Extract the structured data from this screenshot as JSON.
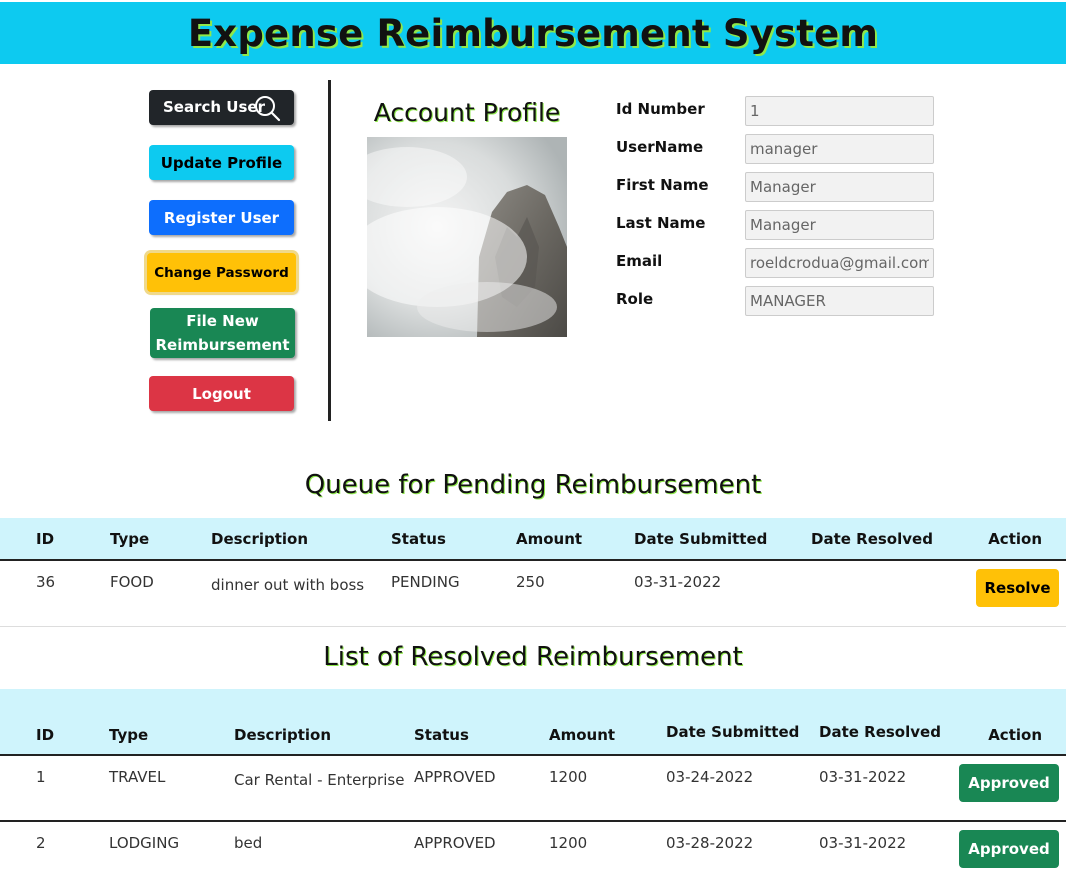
{
  "header": {
    "title": "Expense Reimbursement System"
  },
  "sidebar": {
    "search_label": "Search User",
    "update_label": "Update Profile",
    "register_label": "Register User",
    "change_password_label": "Change Password",
    "file_label": "File New\nReimbursement",
    "logout_label": "Logout"
  },
  "profile": {
    "title": "Account Profile",
    "fields": [
      {
        "label": "Id Number",
        "value": "1"
      },
      {
        "label": "UserName",
        "value": "manager"
      },
      {
        "label": "First Name",
        "value": "Manager"
      },
      {
        "label": "Last Name",
        "value": "Manager"
      },
      {
        "label": "Email",
        "value": "roeldcrodua@gmail.com"
      },
      {
        "label": "Role",
        "value": "MANAGER"
      }
    ]
  },
  "pending": {
    "title": "Queue for Pending Reimbursement",
    "headers": [
      "ID",
      "Type",
      "Description",
      "Status",
      "Amount",
      "Date Submitted",
      "Date Resolved",
      "Action"
    ],
    "rows": [
      {
        "id": "36",
        "type": "FOOD",
        "description": "dinner out with boss",
        "status": "PENDING",
        "amount": "250",
        "submitted": "03-31-2022",
        "resolved": "",
        "action": "Resolve"
      }
    ]
  },
  "resolved": {
    "title": "List of Resolved Reimbursement",
    "headers": [
      "ID",
      "Type",
      "Description",
      "Status",
      "Amount",
      "Date Submitted",
      "Date Resolved",
      "Action"
    ],
    "rows": [
      {
        "id": "1",
        "type": "TRAVEL",
        "description": "Car Rental - Enterprise",
        "status": "APPROVED",
        "amount": "1200",
        "submitted": "03-24-2022",
        "resolved": "03-31-2022",
        "action": "Approved"
      },
      {
        "id": "2",
        "type": "LODGING",
        "description": "bed",
        "status": "APPROVED",
        "amount": "1200",
        "submitted": "03-28-2022",
        "resolved": "03-31-2022",
        "action": "Approved"
      }
    ]
  },
  "colors": {
    "header_bg": "#0dcaf0",
    "table_head_bg": "#cff4fc",
    "success": "#198754",
    "warning": "#ffc107",
    "danger": "#dc3545",
    "primary": "#0d6efd"
  }
}
